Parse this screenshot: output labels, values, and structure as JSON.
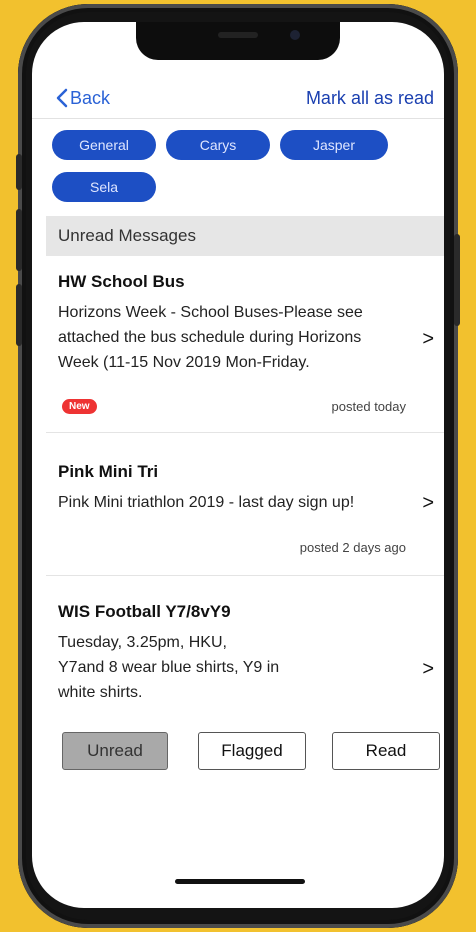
{
  "nav": {
    "back_label": "Back",
    "mark_all_label": "Mark all as read"
  },
  "filters": [
    "General",
    "Carys",
    "Jasper",
    "Sela"
  ],
  "section_title": "Unread Messages",
  "messages": [
    {
      "title": "HW School Bus",
      "body": "Horizons Week - School Buses-Please see attached the bus schedule during Horizons Week (11-15 Nov 2019 Mon-Friday.",
      "badge": "New",
      "posted": "posted today"
    },
    {
      "title": "Pink Mini Tri",
      "body": "Pink Mini triathlon 2019 - last day sign up!",
      "posted": "posted 2 days ago"
    },
    {
      "title": "WIS Football Y7/8vY9",
      "body_lines": [
        "Tuesday, 3.25pm, HKU,",
        "Y7and 8 wear blue shirts, Y9 in",
        "white shirts."
      ]
    }
  ],
  "chevron": ">",
  "tabs": {
    "unread": "Unread",
    "flagged": "Flagged",
    "read": "Read"
  },
  "colors": {
    "background": "#f2c12e",
    "chip": "#1d4fc4",
    "link": "#2a62d6",
    "new_badge": "#e33333"
  }
}
